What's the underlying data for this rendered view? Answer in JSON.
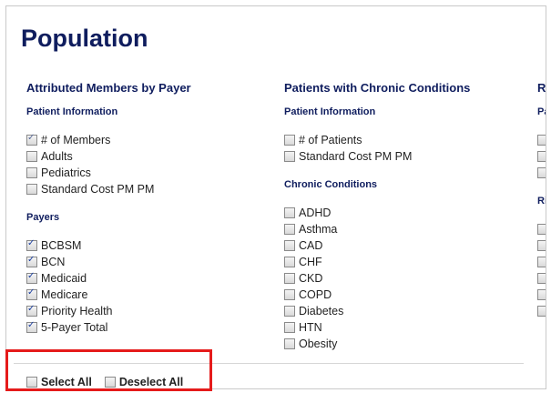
{
  "page": {
    "title": "Population"
  },
  "columns": [
    {
      "heading": "Attributed Members by Payer",
      "groups": [
        {
          "subhead": "Patient Information",
          "items": [
            {
              "label": "# of Members",
              "checked": "partial"
            },
            {
              "label": "Adults",
              "checked": false
            },
            {
              "label": "Pediatrics",
              "checked": false
            },
            {
              "label": "Standard Cost PM PM",
              "checked": false
            }
          ]
        },
        {
          "subhead": "Payers",
          "items": [
            {
              "label": "BCBSM",
              "checked": true
            },
            {
              "label": "BCN",
              "checked": true
            },
            {
              "label": "Medicaid",
              "checked": true
            },
            {
              "label": "Medicare",
              "checked": true
            },
            {
              "label": "Priority Health",
              "checked": true
            },
            {
              "label": "5-Payer Total",
              "checked": true
            }
          ]
        }
      ]
    },
    {
      "heading": "Patients with Chronic Conditions",
      "groups": [
        {
          "subhead": "Patient Information",
          "items": [
            {
              "label": "# of Patients",
              "checked": false
            },
            {
              "label": "Standard Cost PM PM",
              "checked": false
            }
          ]
        },
        {
          "subhead": "Chronic Conditions",
          "items": [
            {
              "label": "ADHD",
              "checked": false
            },
            {
              "label": "Asthma",
              "checked": false
            },
            {
              "label": "CAD",
              "checked": false
            },
            {
              "label": "CHF",
              "checked": false
            },
            {
              "label": "CKD",
              "checked": false
            },
            {
              "label": "COPD",
              "checked": false
            },
            {
              "label": "Diabetes",
              "checked": false
            },
            {
              "label": "HTN",
              "checked": false
            },
            {
              "label": "Obesity",
              "checked": false
            }
          ]
        }
      ]
    }
  ],
  "partial_column": {
    "heading": "R",
    "subhead1": "Pa",
    "subhead2": "Ris"
  },
  "footer": {
    "select_all": "Select All",
    "deselect_all": "Deselect All"
  },
  "colors": {
    "heading": "#0f1d5e",
    "highlight": "#e51b1b"
  }
}
